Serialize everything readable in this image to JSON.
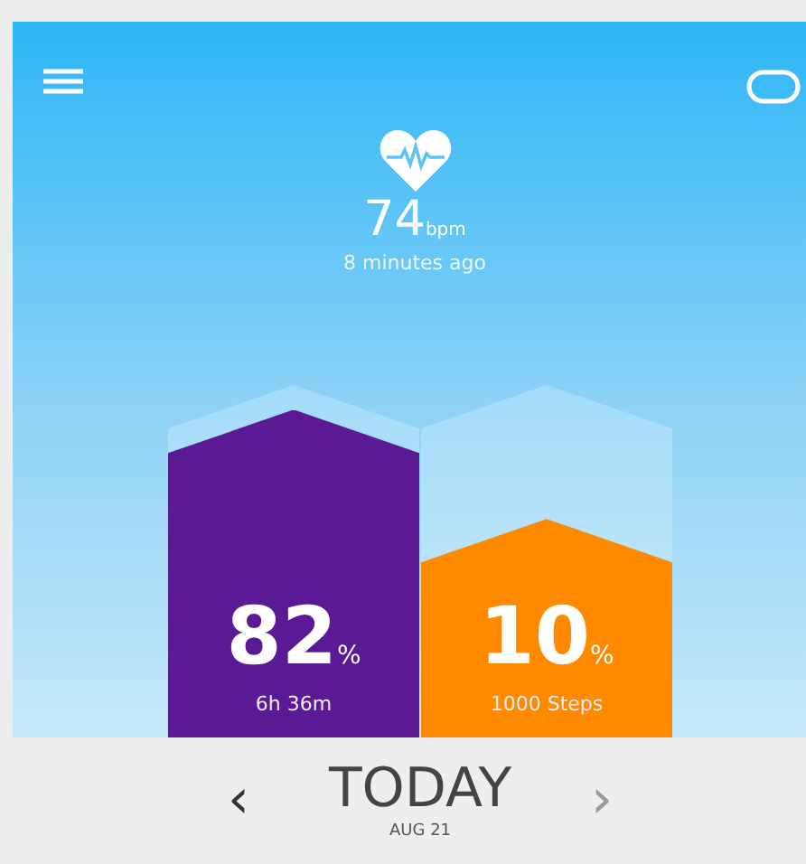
{
  "heart_rate": {
    "value": "74",
    "unit": "bpm",
    "updated": "8 minutes ago"
  },
  "bars": [
    {
      "value": "82",
      "unit": "%",
      "detail": "6h 36m",
      "color": "#5a1a96",
      "level": 0.93
    },
    {
      "value": "10",
      "unit": "%",
      "detail": "1000 Steps",
      "color": "#ff8a00",
      "level": 0.62
    }
  ],
  "date_nav": {
    "prev": "‹",
    "title": "TODAY",
    "date": "AUG 21",
    "next": "›"
  }
}
